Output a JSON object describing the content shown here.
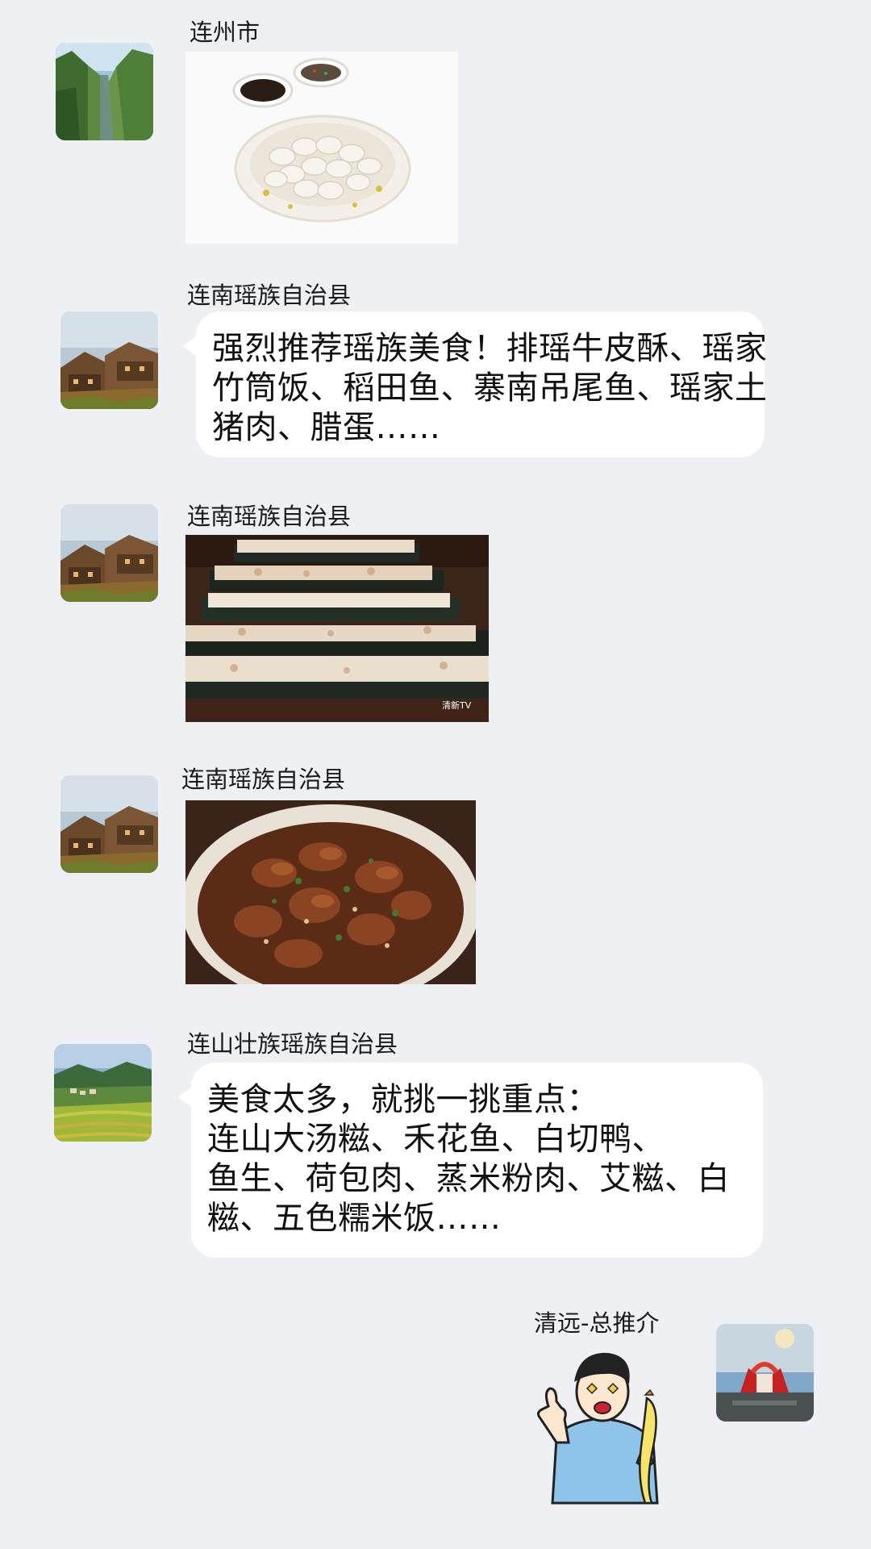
{
  "messages": [
    {
      "sender": "连州市",
      "avatar": "river-gorge-avatar",
      "type": "image",
      "image": "dumplings-plate-photo"
    },
    {
      "sender": "连南瑶族自治县",
      "avatar": "village-houses-avatar",
      "type": "text",
      "lines": [
        "强烈推荐瑶族美食！排瑶牛皮酥、瑶家",
        "竹筒饭、稻田鱼、寨南吊尾鱼、瑶家土",
        "猪肉、腊蛋……"
      ]
    },
    {
      "sender": "连南瑶族自治县",
      "avatar": "village-houses-avatar",
      "type": "image",
      "image": "bamboo-tube-rice-photo",
      "watermark": "清新TV"
    },
    {
      "sender": "连南瑶族自治县",
      "avatar": "village-houses-avatar",
      "type": "image",
      "image": "stewed-meat-bowl-photo"
    },
    {
      "sender": "连山壮族瑶族自治县",
      "avatar": "terraced-fields-avatar",
      "type": "text",
      "lines": [
        "美食太多，就挑一挑重点：",
        "连山大汤糍、禾花鱼、白切鸭、",
        "鱼生、荷包肉、蒸米粉肉、艾糍、白",
        "糍、五色糯米饭……"
      ]
    },
    {
      "sender": "清远-总推介",
      "avatar": "red-monument-avatar",
      "type": "sticker",
      "image": "thumbs-up-cartoon-sticker"
    }
  ]
}
